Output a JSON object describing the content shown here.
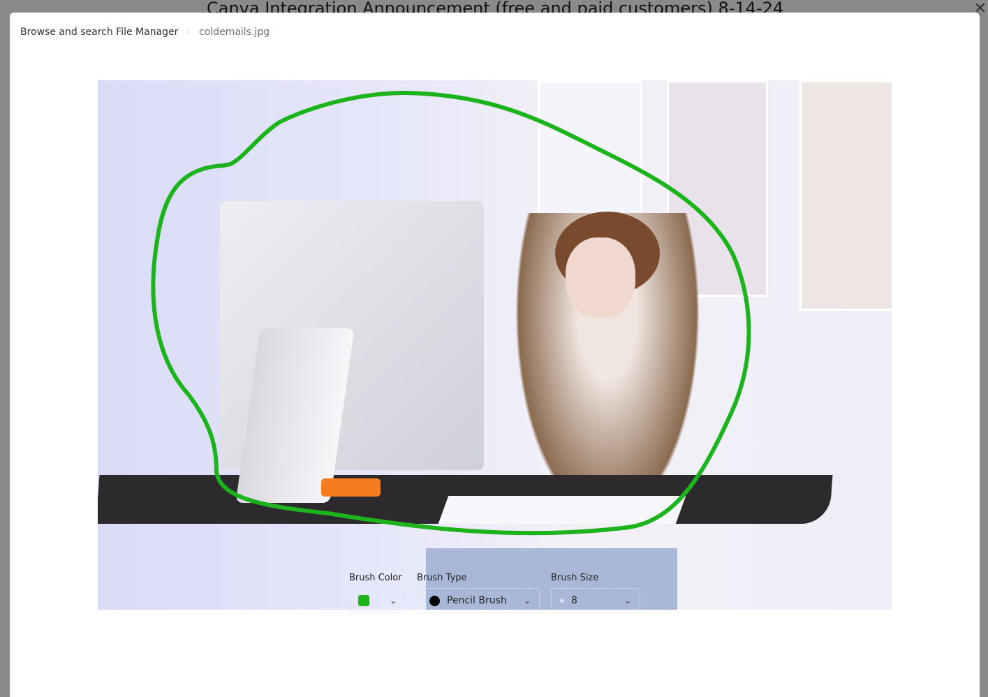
{
  "background": {
    "title": "Canva Integration Announcement (free and paid customers) 8-14-24"
  },
  "breadcrumb": {
    "root": "Browse and search File Manager",
    "separator": "›",
    "current": "coldemails.jpg"
  },
  "image": {
    "brush_stroke_color": "#1cb31c"
  },
  "toolbar": {
    "brush_color": {
      "label": "Brush Color",
      "value": "#1cb31c"
    },
    "brush_type": {
      "label": "Brush Type",
      "value": "Pencil Brush"
    },
    "brush_size": {
      "label": "Brush Size",
      "value": "8"
    }
  }
}
